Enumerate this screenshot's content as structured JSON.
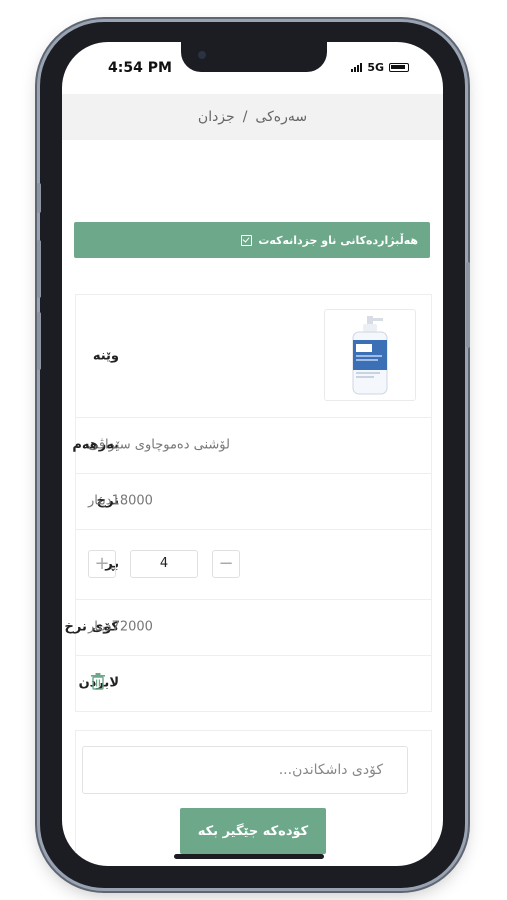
{
  "status_bar": {
    "time": "4:54 PM",
    "network": "5G"
  },
  "breadcrumb": {
    "home": "سەرەکی",
    "separator": "/",
    "current": "جزدان"
  },
  "alert": {
    "text": "هەڵبژاردەکانی ناو جزدانەکەت",
    "icon": "checkbox-icon"
  },
  "cart": {
    "image_label": "وێنە",
    "product_label": "بەرهەم",
    "product_name": "لۆشنی دەموچاوی سێراڤی",
    "price_label": "نرخ",
    "price_value": "18000دینار",
    "quantity_label": "بڕ",
    "quantity_value": "4",
    "total_label": "کۆی نرخ",
    "total_value": "72000دینار",
    "remove_label": "لابردن"
  },
  "coupon": {
    "placeholder": "کۆدی داشکاندن...",
    "button_label": "کۆدەکە جێگیر بکە"
  },
  "colors": {
    "accent": "#6da88a"
  }
}
